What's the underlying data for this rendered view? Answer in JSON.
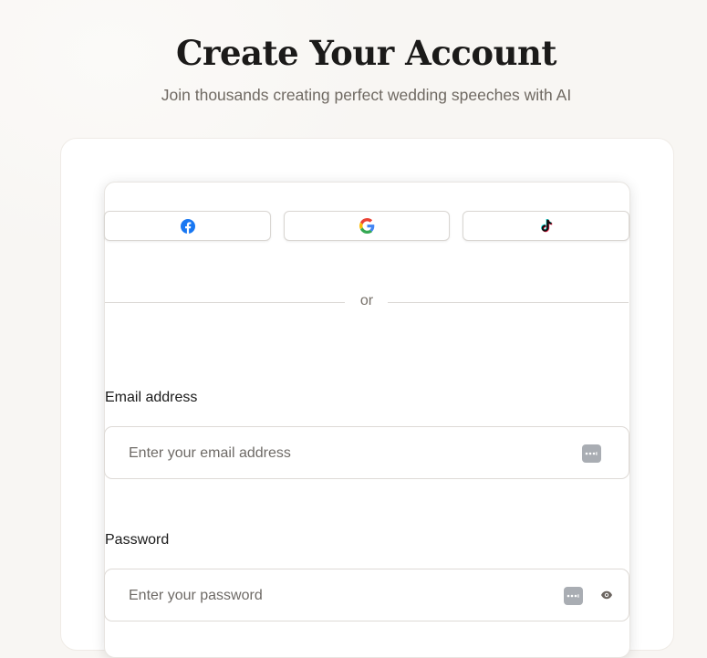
{
  "header": {
    "title": "Create Your Account",
    "subtitle": "Join thousands creating perfect wedding speeches with AI"
  },
  "social": {
    "buttons": [
      {
        "provider": "Facebook",
        "icon": "facebook-icon"
      },
      {
        "provider": "Google",
        "icon": "google-icon"
      },
      {
        "provider": "TikTok",
        "icon": "tiktok-icon"
      }
    ]
  },
  "divider": {
    "text": "or"
  },
  "form": {
    "email": {
      "label": "Email address",
      "placeholder": "Enter your email address",
      "value": "",
      "icon": "password-manager-icon"
    },
    "password": {
      "label": "Password",
      "placeholder": "Enter your password",
      "value": "",
      "icons": [
        "password-manager-icon",
        "eye-icon"
      ]
    }
  },
  "colors": {
    "background": "#f8f6f3",
    "title": "#1b1a19",
    "subtitle": "#6f6962",
    "facebook": "#1877F2",
    "google_blue": "#4285F4",
    "google_red": "#EA4335",
    "google_yellow": "#FBBC05",
    "google_green": "#34A853",
    "password_manager": "#a9adb3"
  }
}
